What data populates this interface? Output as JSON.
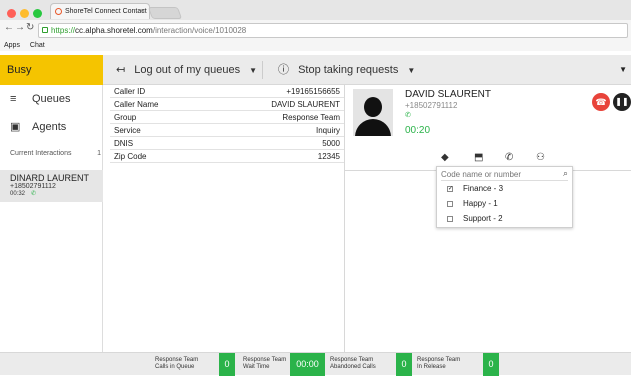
{
  "browser": {
    "tab_title": "ShoreTel Connect Contact",
    "tab_close": "×",
    "url_scheme": "https://",
    "url_host": "cc.alpha.shoretel.com",
    "url_path": "/interaction/voice/1010028",
    "bookmarks": [
      "Apps",
      "Chat"
    ],
    "traffic_colors": [
      "#ff5f57",
      "#febc2e",
      "#28c840"
    ]
  },
  "topbar": {
    "status": "Busy",
    "logout_label": "Log out of my queues",
    "stop_label": "Stop taking requests"
  },
  "sidebar": {
    "queues": "Queues",
    "agents": "Agents",
    "current_label": "Current Interactions",
    "current_count": "1",
    "interaction": {
      "name": "DINARD LAURENT",
      "phone": "+18502791112",
      "time": "00:32"
    }
  },
  "call_info": [
    {
      "key": "Caller ID",
      "value": "+19165156655"
    },
    {
      "key": "Caller Name",
      "value": "DAVID SLAURENT"
    },
    {
      "key": "Group",
      "value": "Response Team"
    },
    {
      "key": "Service",
      "value": "Inquiry"
    },
    {
      "key": "DNIS",
      "value": "5000"
    },
    {
      "key": "Zip Code",
      "value": "12345"
    }
  ],
  "caller": {
    "name": "DAVID SLAURENT",
    "phone": "+18502791112",
    "timer": "00:20"
  },
  "transfer": {
    "placeholder": "Code name or number",
    "options": [
      {
        "label": "Finance - 3",
        "checked": true
      },
      {
        "label": "Happy - 1",
        "checked": false
      },
      {
        "label": "Support - 2",
        "checked": false
      }
    ]
  },
  "stats": [
    {
      "line1": "Response Team",
      "line2": "Calls in Queue",
      "value": "0"
    },
    {
      "line1": "Response Team",
      "line2": "Wait Time",
      "value": "00:00"
    },
    {
      "line1": "Response Team",
      "line2": "Abandoned Calls",
      "value": "0"
    },
    {
      "line1": "Response Team",
      "line2": "In Release",
      "value": "0"
    }
  ],
  "colors": {
    "status_yellow": "#f5c400",
    "accent_green": "#2bb34a",
    "hangup_red": "#e8433a"
  }
}
